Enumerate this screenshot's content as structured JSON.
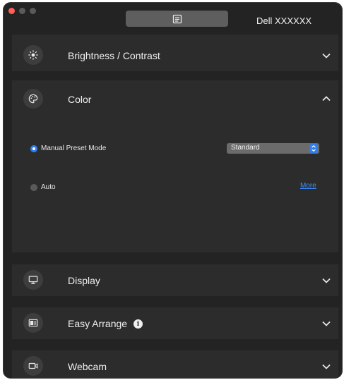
{
  "window": {
    "monitor_name": "Dell XXXXXX",
    "center_button_icon": "document-icon"
  },
  "sections": {
    "brightness": {
      "title": "Brightness / Contrast",
      "icon": "sun-icon",
      "expanded": false
    },
    "color": {
      "title": "Color",
      "icon": "palette-icon",
      "expanded": true,
      "manual_preset_label": "Manual Preset Mode",
      "manual_preset_selected": true,
      "preset_value": "Standard",
      "auto_label": "Auto",
      "auto_selected": false,
      "more_link": "More"
    },
    "display": {
      "title": "Display",
      "icon": "monitor-icon",
      "expanded": false
    },
    "easy_arrange": {
      "title": "Easy Arrange",
      "icon": "layout-icon",
      "info_icon": "info-icon",
      "expanded": false
    },
    "webcam": {
      "title": "Webcam",
      "icon": "video-camera-icon",
      "expanded": false
    }
  },
  "colors": {
    "accent": "#2f7ef0",
    "link": "#3a8eff",
    "window_bg": "#232323",
    "panel_bg": "#2c2c2c"
  }
}
